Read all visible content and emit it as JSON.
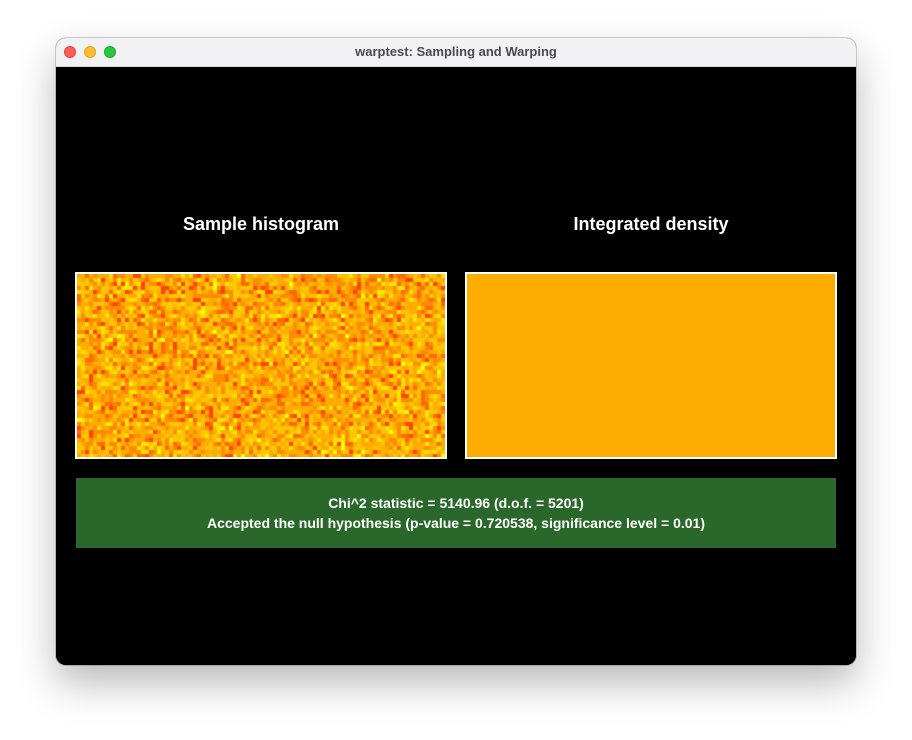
{
  "window": {
    "title": "warptest: Sampling and Warping"
  },
  "panels": {
    "left_title": "Sample histogram",
    "right_title": "Integrated density"
  },
  "result": {
    "line1": "Chi^2 statistic = 5140.96 (d.o.f. = 5201)",
    "line2": "Accepted the null hypothesis (p-value = 0.720538, significance level = 0.01)",
    "background_color": "#29672a"
  },
  "colors": {
    "density_fill": "#ffac00",
    "histogram_palette": [
      "#ffff00",
      "#ffe200",
      "#ffc600",
      "#ffac00",
      "#ff8c00",
      "#ff6a00",
      "#ff4500"
    ],
    "panel_border": "#ffffff"
  },
  "icons": {
    "close": "close-icon",
    "minimize": "minimize-icon",
    "zoom": "zoom-icon"
  }
}
